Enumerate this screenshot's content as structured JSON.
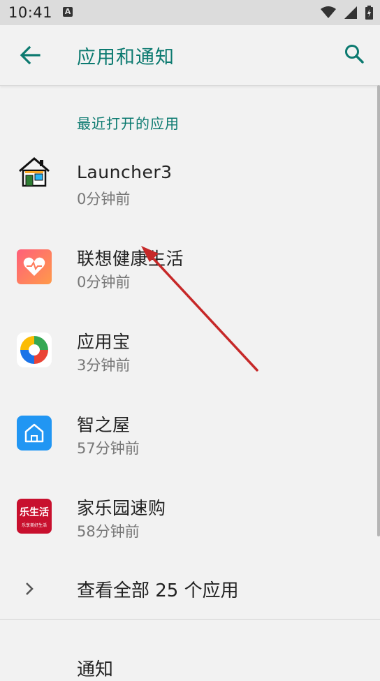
{
  "status_bar": {
    "time": "10:41",
    "notification_letter": "A"
  },
  "header": {
    "title": "应用和通知",
    "back_icon": "arrow-back-icon",
    "search_icon": "search-icon"
  },
  "section": {
    "label": "最近打开的应用"
  },
  "apps": [
    {
      "name": "Launcher3",
      "time": "0分钟前",
      "icon": "launcher3-house-icon"
    },
    {
      "name": "联想健康生活",
      "time": "0分钟前",
      "icon": "lenovo-health-heart-icon"
    },
    {
      "name": "应用宝",
      "time": "3分钟前",
      "icon": "yingyongbao-icon"
    },
    {
      "name": "智之屋",
      "time": "57分钟前",
      "icon": "zhizhiwu-house-icon"
    },
    {
      "name": "家乐园速购",
      "time": "58分钟前",
      "icon": "leshenghuo-icon",
      "icon_text": "乐生活",
      "icon_subtext": "乐享美好生活"
    }
  ],
  "see_all": {
    "label": "查看全部 25 个应用"
  },
  "notifications": {
    "label": "通知"
  },
  "colors": {
    "accent": "#0c7a70",
    "annotation_arrow": "#c62828"
  }
}
